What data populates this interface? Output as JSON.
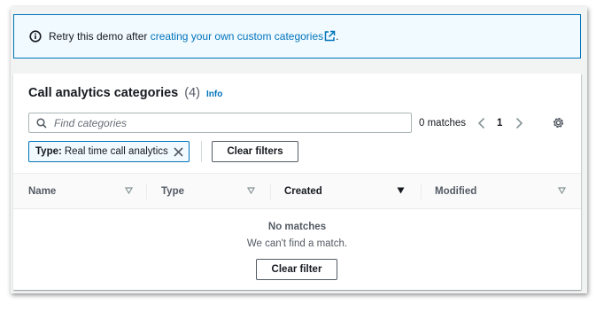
{
  "alert": {
    "text": "Retry this demo after ",
    "link_text": "creating your own custom categories",
    "suffix": "."
  },
  "panel": {
    "title": "Call analytics categories",
    "count": "(4)",
    "info_label": "Info"
  },
  "search": {
    "placeholder": "Find categories",
    "value": ""
  },
  "pagination": {
    "matches": "0 matches",
    "current_page": "1"
  },
  "filter_token": {
    "key": "Type:",
    "value": "Real time call analytics"
  },
  "buttons": {
    "clear_filters": "Clear filters",
    "clear_filter": "Clear filter"
  },
  "table": {
    "columns": [
      "Name",
      "Type",
      "Created",
      "Modified"
    ],
    "sorted_column": "Created",
    "sort_direction": "descending"
  },
  "empty_state": {
    "title": "No matches",
    "description": "We can't find a match."
  },
  "colors": {
    "link": "#0073bb",
    "alert_bg": "#f1faff",
    "text": "#16191f",
    "muted": "#545b64"
  },
  "icons": [
    "info-icon",
    "external-link-icon",
    "search-icon",
    "chevron-left-icon",
    "chevron-right-icon",
    "settings-gear-icon",
    "close-icon",
    "sort-icon",
    "sort-descending-icon"
  ]
}
